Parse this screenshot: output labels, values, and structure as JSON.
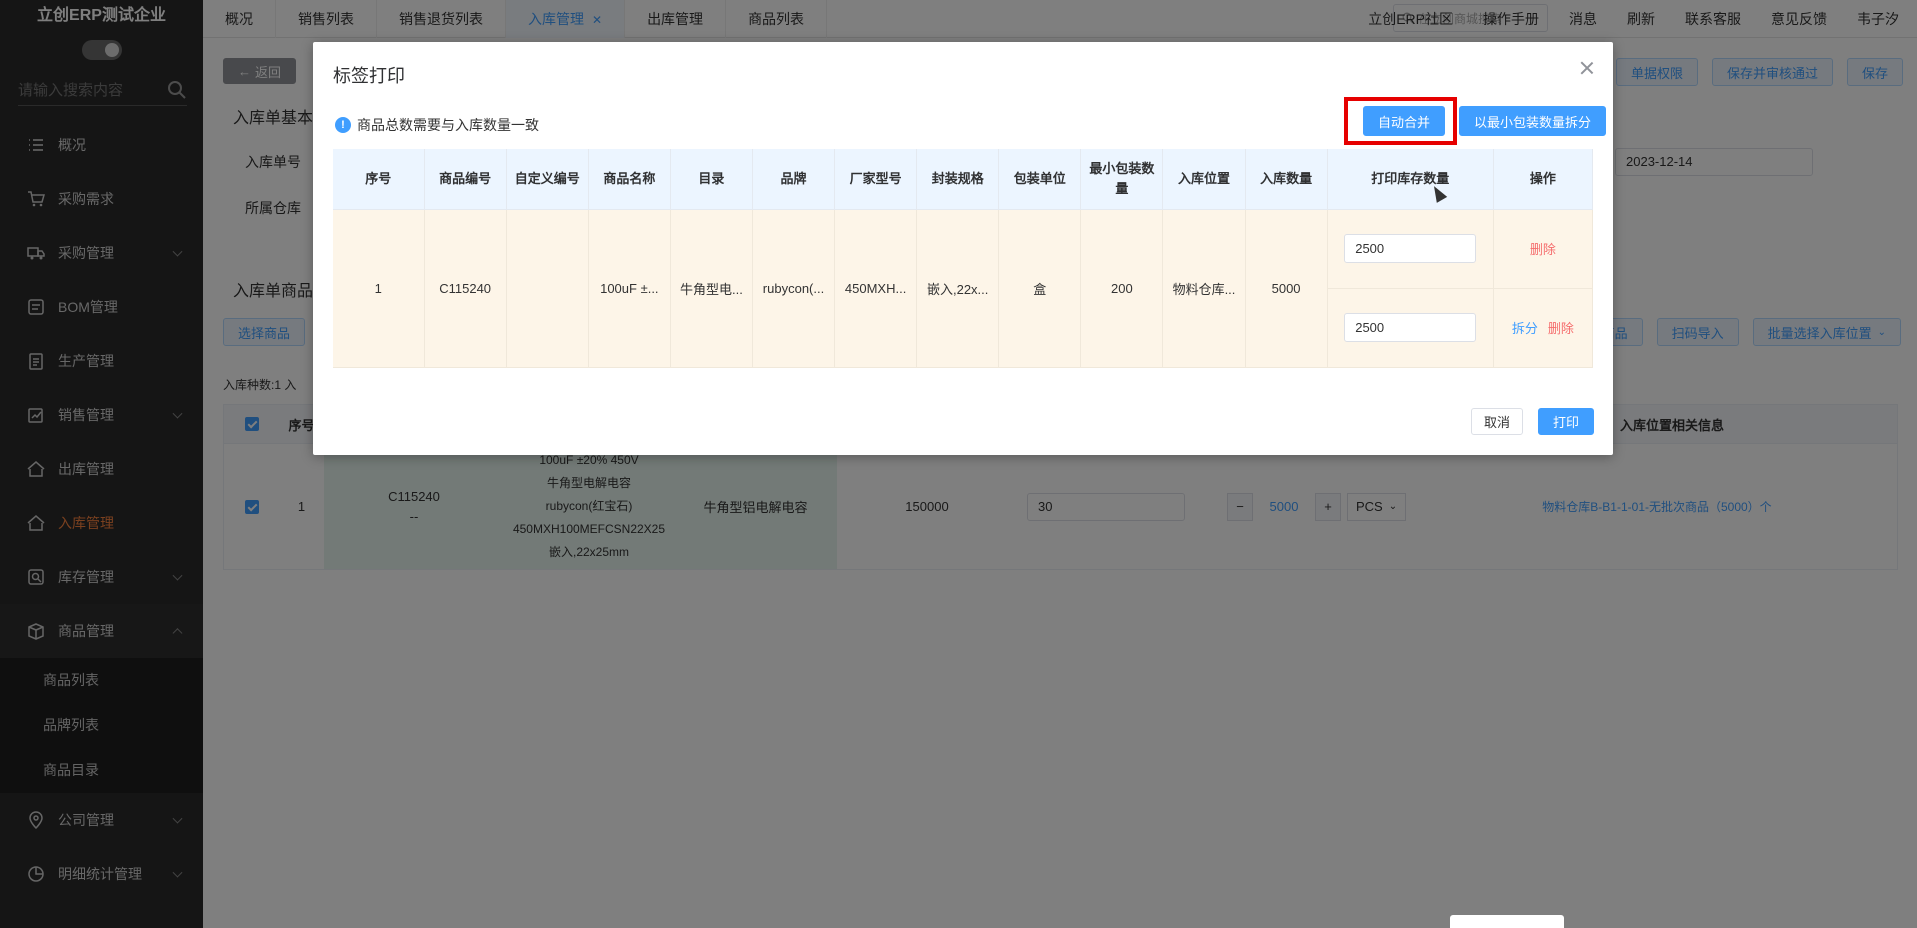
{
  "sidebar": {
    "company": "立创ERP测试企业",
    "search_placeholder": "请输入搜索内容",
    "items": [
      {
        "label": "概况",
        "icon": "list-icon"
      },
      {
        "label": "采购需求",
        "icon": "cart-icon"
      },
      {
        "label": "采购管理",
        "icon": "truck-icon"
      },
      {
        "label": "BOM管理",
        "icon": "document-icon"
      },
      {
        "label": "生产管理",
        "icon": "clipboard-icon"
      },
      {
        "label": "销售管理",
        "icon": "sales-icon"
      },
      {
        "label": "出库管理",
        "icon": "outbound-icon"
      },
      {
        "label": "入库管理",
        "icon": "inbound-icon"
      },
      {
        "label": "库存管理",
        "icon": "inventory-icon"
      },
      {
        "label": "商品管理",
        "icon": "box-icon"
      }
    ],
    "sub_items": [
      "商品列表",
      "品牌列表",
      "商品目录"
    ],
    "items_after": [
      {
        "label": "公司管理",
        "icon": "location-icon"
      },
      {
        "label": "明细统计管理",
        "icon": "pie-chart-icon"
      }
    ]
  },
  "topbar": {
    "tabs": [
      "概况",
      "销售列表",
      "销售退货列表",
      "入库管理",
      "出库管理",
      "商品列表"
    ],
    "active_tab": "入库管理",
    "search_placeholder": "在立创商城搜索",
    "links": [
      "立创ERP社区",
      "操作手册",
      "消息",
      "刷新",
      "联系客服",
      "意见反馈",
      "韦子汐"
    ]
  },
  "background": {
    "back_label": "返回",
    "basic_title": "入库单基本",
    "order_no_label": "入库单号",
    "warehouse_label": "所属仓库",
    "date_value": "2023-12-14",
    "goods_title": "入库单商品",
    "select_goods_label": "选择商品",
    "kinds_text": "入库种数:1  入",
    "right_buttons": [
      "单据权限",
      "保存并审核通过",
      "保存"
    ],
    "row_buttons": [
      "商品",
      "扫码导入",
      "批量选择入库位置"
    ],
    "table_head": [
      "序号",
      "入库位置相关信息"
    ],
    "row": {
      "index": "1",
      "code": "C115240",
      "code_sub": "--",
      "desc_lines": [
        "100uF ±20% 450V",
        "牛角型电解电容",
        "rubycon(红宝石)",
        "450MXH100MEFCSN22X25",
        "嵌入,22x25mm"
      ],
      "category": "牛角型铝电解电容",
      "stock": "150000",
      "price": "30",
      "qty": "5000",
      "unit": "PCS",
      "location": "物料仓库B-B1-1-01-无批次商品（5000）个"
    }
  },
  "dialog": {
    "title": "标签打印",
    "notice": "商品总数需要与入库数量一致",
    "btn_auto_merge": "自动合并",
    "btn_split_min": "以最小包装数量拆分",
    "columns": [
      "序号",
      "商品编号",
      "自定义编号",
      "商品名称",
      "目录",
      "品牌",
      "厂家型号",
      "封装规格",
      "包装单位",
      "最小包装数量",
      "入库位置",
      "入库数量",
      "打印库存数量",
      "操作"
    ],
    "row": {
      "index": "1",
      "code": "C115240",
      "custom_code": "",
      "name": "100uF ±...",
      "category": "牛角型电...",
      "brand": "rubycon(...",
      "model": "450MXH...",
      "package": "嵌入,22x...",
      "unit": "盒",
      "min_pack": "200",
      "location": "物料仓库...",
      "in_qty": "5000"
    },
    "print_qty": [
      "2500",
      "2500"
    ],
    "op_split": "拆分",
    "op_delete": "删除",
    "btn_cancel": "取消",
    "btn_print": "打印"
  },
  "colors": {
    "primary": "#409eff",
    "danger": "#f56c6c",
    "accent_orange": "#f5803e",
    "highlight_red": "#e60000"
  }
}
